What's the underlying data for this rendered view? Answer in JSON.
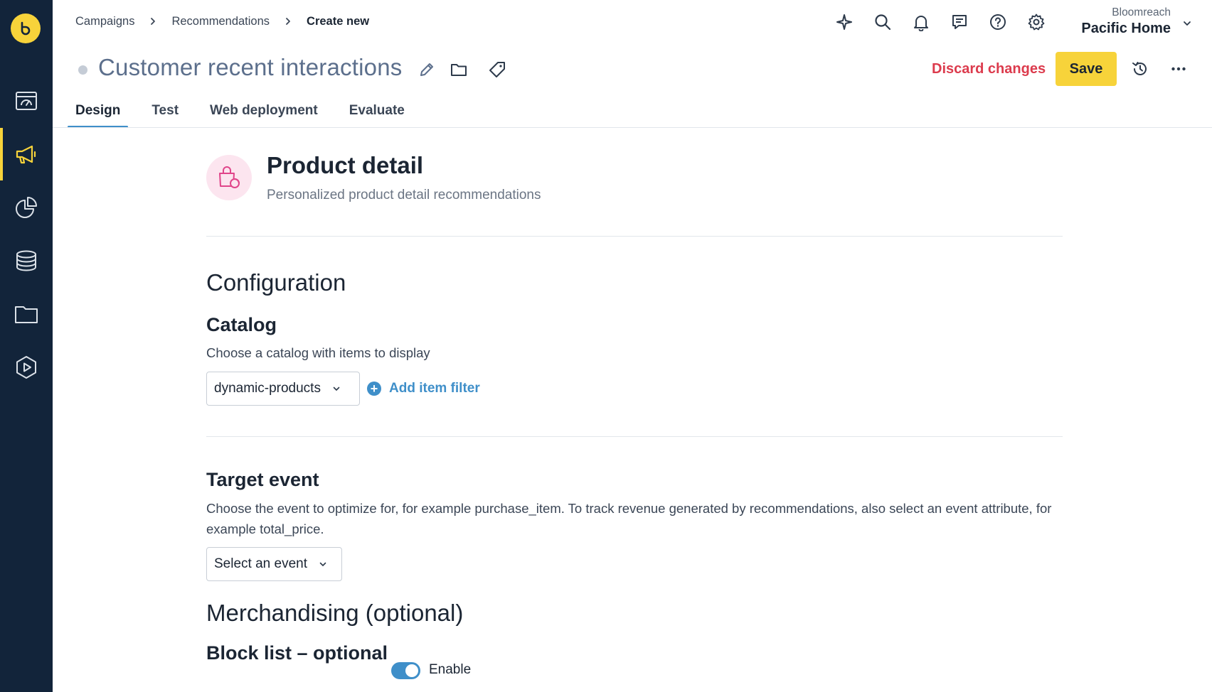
{
  "rail": {
    "items": [
      {
        "icon": "dashboard-icon"
      },
      {
        "icon": "campaigns-megaphone-icon",
        "active": true
      },
      {
        "icon": "analytics-pie-icon"
      },
      {
        "icon": "data-database-icon"
      },
      {
        "icon": "assets-folder-icon"
      },
      {
        "icon": "play-hexagon-icon"
      }
    ]
  },
  "breadcrumb": {
    "items": [
      "Campaigns",
      "Recommendations"
    ],
    "current": "Create new"
  },
  "account": {
    "org": "Bloomreach",
    "project": "Pacific Home"
  },
  "header": {
    "title": "Customer recent interactions",
    "discard_label": "Discard changes",
    "save_label": "Save"
  },
  "tabs": [
    {
      "label": "Design",
      "active": true
    },
    {
      "label": "Test"
    },
    {
      "label": "Web deployment"
    },
    {
      "label": "Evaluate"
    }
  ],
  "template": {
    "title": "Product detail",
    "subtitle": "Personalized product detail recommendations"
  },
  "configuration": {
    "heading": "Configuration",
    "catalog": {
      "title": "Catalog",
      "description": "Choose a catalog with items to display",
      "selected": "dynamic-products",
      "add_filter_label": "Add item filter"
    },
    "target_event": {
      "title": "Target event",
      "description": "Choose the event to optimize for, for example purchase_item. To track revenue generated by recommendations, also select an event attribute, for example total_price.",
      "placeholder": "Select an event"
    }
  },
  "merchandising": {
    "heading": "Merchandising (optional)",
    "block_list": {
      "title": "Block list – optional",
      "toggle_label": "Enable",
      "enabled": true
    }
  },
  "colors": {
    "rail_bg": "#12243a",
    "brand_yellow": "#f7d33a",
    "accent_blue": "#3f8fc9",
    "danger_red": "#dc3b4d",
    "title_slate": "#5c6f8c"
  }
}
